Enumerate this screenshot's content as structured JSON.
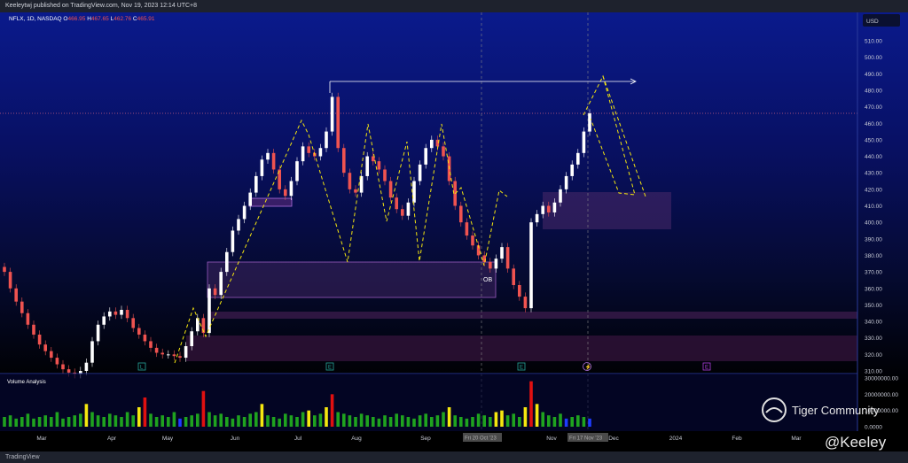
{
  "header": {
    "published": "Keeleytwj published on TradingView.com, Nov 19, 2023 12:14 UTC+8"
  },
  "legend": {
    "symbol": "NFLX, 1D, NASDAQ",
    "o_label": "O",
    "o": "466.95",
    "h_label": "H",
    "h": "467.65",
    "l_label": "L",
    "l": "462.76",
    "c_label": "C",
    "c": "465.91"
  },
  "currency": "USD",
  "volume_title": "Volume Analysis",
  "annotation_ob": "OB",
  "events": [
    "L",
    "E",
    "E",
    "⚡",
    "E"
  ],
  "crosshair_labels": {
    "oct": "Fri 20 Oct '23",
    "nov": "Fri 17 Nov '23"
  },
  "watermark": {
    "brand": "Tiger Community",
    "handle": "@Keeley"
  },
  "footer": {
    "logo": "TradingView"
  },
  "colors": {
    "up": "#ffffff",
    "down": "#ef5350",
    "vol_normal": "#1fa31f",
    "vol_high": "#f5e70f",
    "vol_extreme": "#e01010",
    "vol_low": "#1e3cff",
    "zone": "#3a1a55"
  },
  "chart_data": {
    "type": "candlestick",
    "title": "NFLX, 1D, NASDAQ",
    "ylim": [
      305,
      515
    ],
    "price_ticks": [
      "510.00",
      "500.00",
      "490.00",
      "480.00",
      "470.00",
      "460.00",
      "450.00",
      "440.00",
      "430.00",
      "420.00",
      "410.00",
      "400.00",
      "390.00",
      "380.00",
      "370.00",
      "360.00",
      "350.00",
      "340.00",
      "330.00",
      "320.00",
      "310.00"
    ],
    "volume_ticks": [
      "30000000.00",
      "20000000.00",
      "10000000.00",
      "0.0000"
    ],
    "x_ticks": [
      "Mar",
      "Apr",
      "May",
      "Jun",
      "Jul",
      "Aug",
      "Sep",
      "Oct",
      "Nov",
      "Dec",
      "2024",
      "Feb",
      "Mar"
    ],
    "closes": [
      370,
      360,
      352,
      345,
      338,
      332,
      326,
      322,
      318,
      314,
      311,
      309,
      308,
      310,
      315,
      328,
      338,
      343,
      346,
      344,
      347,
      342,
      336,
      332,
      328,
      324,
      321,
      320,
      320,
      319,
      318,
      325,
      334,
      342,
      333,
      360,
      356,
      370,
      382,
      395,
      402,
      410,
      418,
      428,
      438,
      442,
      432,
      420,
      416,
      425,
      437,
      446,
      442,
      440,
      445,
      455,
      476,
      445,
      430,
      420,
      418,
      428,
      440,
      437,
      432,
      425,
      415,
      408,
      404,
      412,
      425,
      435,
      445,
      450,
      446,
      440,
      425,
      410,
      400,
      392,
      386,
      380,
      376,
      372,
      378,
      385,
      372,
      362,
      355,
      348,
      400,
      405,
      410,
      406,
      412,
      420,
      428,
      435,
      442,
      455,
      466
    ],
    "volume_millions": [
      6,
      7,
      5,
      6,
      8,
      5,
      6,
      7,
      6,
      9,
      5,
      6,
      7,
      8,
      14,
      9,
      7,
      6,
      8,
      7,
      6,
      9,
      7,
      12,
      18,
      8,
      6,
      7,
      6,
      9,
      5,
      6,
      7,
      8,
      22,
      9,
      7,
      8,
      6,
      5,
      7,
      6,
      8,
      9,
      14,
      7,
      6,
      5,
      8,
      7,
      6,
      9,
      10,
      7,
      8,
      12,
      20,
      9,
      8,
      7,
      6,
      8,
      7,
      6,
      5,
      7,
      6,
      8,
      7,
      6,
      5,
      7,
      8,
      6,
      7,
      9,
      12,
      7,
      6,
      5,
      6,
      8,
      7,
      6,
      9,
      10,
      7,
      8,
      6,
      12,
      28,
      14,
      9,
      7,
      6,
      8,
      5,
      6,
      7,
      6,
      5
    ],
    "volume_level": [
      0,
      0,
      0,
      0,
      0,
      0,
      0,
      0,
      0,
      0,
      0,
      0,
      0,
      0,
      1,
      0,
      0,
      0,
      0,
      0,
      0,
      0,
      0,
      1,
      2,
      0,
      0,
      0,
      0,
      0,
      3,
      0,
      0,
      0,
      2,
      0,
      0,
      0,
      0,
      0,
      0,
      0,
      0,
      0,
      1,
      0,
      0,
      0,
      0,
      0,
      0,
      0,
      1,
      0,
      0,
      1,
      2,
      0,
      0,
      0,
      0,
      0,
      0,
      0,
      0,
      0,
      0,
      0,
      0,
      0,
      0,
      0,
      0,
      0,
      0,
      0,
      1,
      0,
      0,
      0,
      0,
      0,
      0,
      0,
      1,
      1,
      0,
      0,
      0,
      1,
      2,
      1,
      0,
      0,
      0,
      0,
      3,
      0,
      0,
      0,
      3
    ]
  }
}
